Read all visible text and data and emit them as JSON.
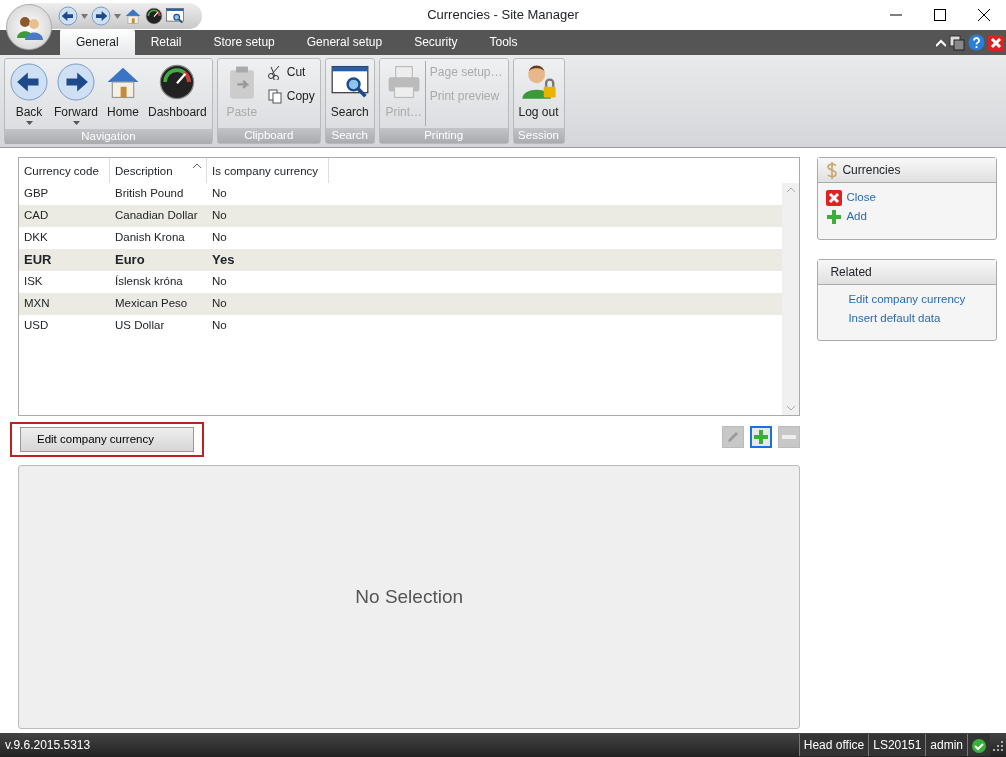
{
  "window": {
    "title": "Currencies - Site Manager"
  },
  "tabs": [
    {
      "label": "General",
      "selected": true
    },
    {
      "label": "Retail",
      "selected": false
    },
    {
      "label": "Store setup",
      "selected": false
    },
    {
      "label": "General setup",
      "selected": false
    },
    {
      "label": "Security",
      "selected": false
    },
    {
      "label": "Tools",
      "selected": false
    }
  ],
  "ribbon": {
    "groups": [
      {
        "label": "Navigation",
        "buttons": [
          {
            "kind": "back",
            "label": "Back",
            "dropdown": true,
            "disabled": false
          },
          {
            "kind": "forward",
            "label": "Forward",
            "dropdown": true,
            "disabled": false
          },
          {
            "kind": "home",
            "label": "Home",
            "dropdown": false,
            "disabled": false
          },
          {
            "kind": "dashboard",
            "label": "Dashboard",
            "dropdown": false,
            "disabled": false
          }
        ]
      },
      {
        "label": "Clipboard",
        "buttons": [
          {
            "kind": "paste",
            "label": "Paste",
            "dropdown": false,
            "disabled": true
          }
        ],
        "small_buttons": [
          {
            "kind": "cut",
            "label": "Cut",
            "disabled": false
          },
          {
            "kind": "copy",
            "label": "Copy",
            "disabled": false
          }
        ]
      },
      {
        "label": "Search",
        "buttons": [
          {
            "kind": "search",
            "label": "Search",
            "dropdown": false,
            "disabled": false
          }
        ]
      },
      {
        "label": "Printing",
        "buttons": [
          {
            "kind": "print",
            "label": "Print…",
            "dropdown": false,
            "disabled": true
          }
        ],
        "small_buttons": [
          {
            "kind": "none",
            "label": "Page setup…",
            "disabled": true
          },
          {
            "kind": "none",
            "label": "Print preview",
            "disabled": true
          }
        ]
      },
      {
        "label": "Session",
        "buttons": [
          {
            "kind": "logout",
            "label": "Log out",
            "dropdown": false,
            "disabled": false
          }
        ]
      }
    ]
  },
  "grid": {
    "columns": [
      {
        "label": "Currency code",
        "sorted": false
      },
      {
        "label": "Description",
        "sorted": true
      },
      {
        "label": "Is company currency",
        "sorted": false
      }
    ],
    "rows": [
      {
        "cells": [
          "GBP",
          "British Pound",
          "No"
        ],
        "company": false
      },
      {
        "cells": [
          "CAD",
          "Canadian Dollar",
          "No"
        ],
        "company": false
      },
      {
        "cells": [
          "DKK",
          "Danish Krona",
          "No"
        ],
        "company": false
      },
      {
        "cells": [
          "EUR",
          "Euro",
          "Yes"
        ],
        "company": true
      },
      {
        "cells": [
          "ISK",
          "Íslensk króna",
          "No"
        ],
        "company": false
      },
      {
        "cells": [
          "MXN",
          "Mexican Peso",
          "No"
        ],
        "company": false
      },
      {
        "cells": [
          "USD",
          "US Dollar",
          "No"
        ],
        "company": false
      }
    ]
  },
  "edit_button": {
    "label": "Edit company currency",
    "highlighted": true
  },
  "row_tools": [
    {
      "kind": "edit",
      "disabled": true,
      "focused": false
    },
    {
      "kind": "add",
      "disabled": false,
      "focused": true
    },
    {
      "kind": "remove",
      "disabled": true,
      "focused": false
    }
  ],
  "detail": {
    "message": "No Selection"
  },
  "side_panels": [
    {
      "title": "Currencies",
      "items": [
        {
          "kind": "close",
          "label": "Close"
        },
        {
          "kind": "add",
          "label": "Add"
        }
      ]
    },
    {
      "title": "Related",
      "items": [
        {
          "kind": "none",
          "label": "Edit company currency"
        },
        {
          "kind": "none",
          "label": "Insert default data"
        }
      ]
    }
  ],
  "status_bar": {
    "version": "v.9.6.2015.5313",
    "items": [
      "Head office",
      "LS20151",
      "admin"
    ],
    "connected": true
  }
}
